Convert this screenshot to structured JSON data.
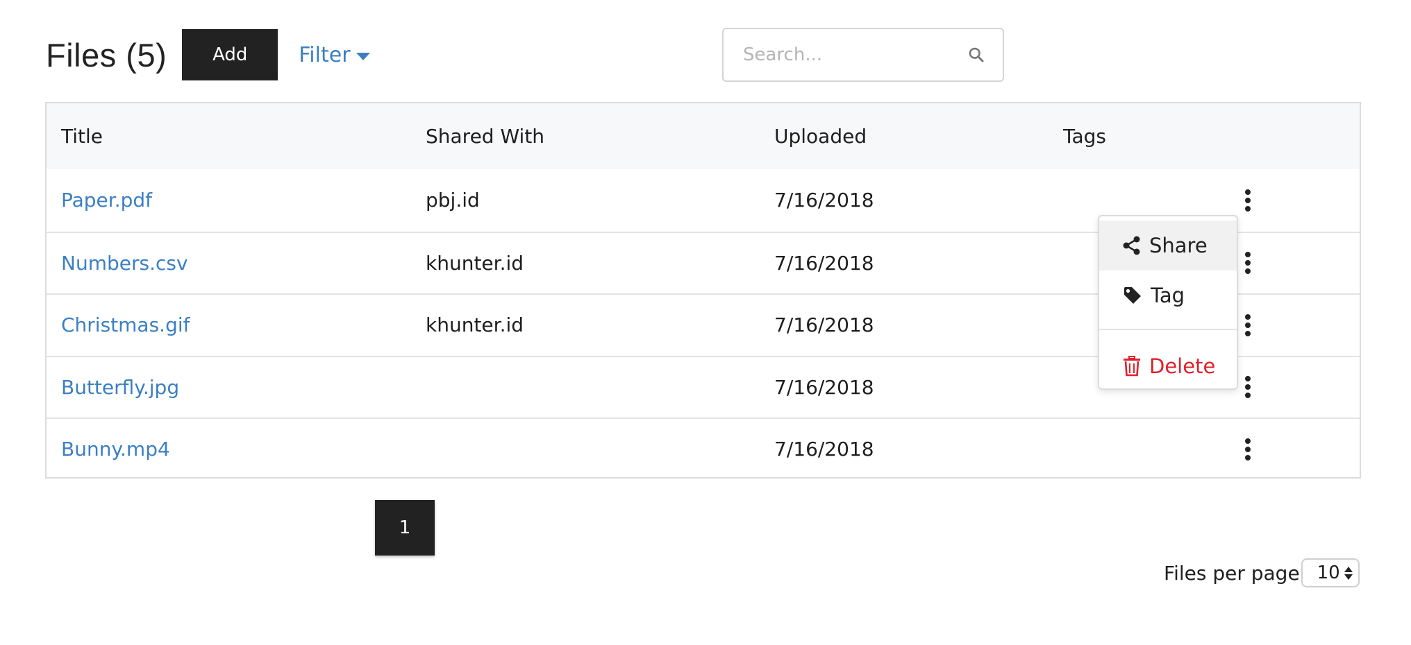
{
  "header": {
    "title": "Files (5)",
    "add_label": "Add",
    "filter_label": "Filter"
  },
  "search": {
    "placeholder": "Search..."
  },
  "table": {
    "columns": [
      "Title",
      "Shared With",
      "Uploaded",
      "Tags"
    ],
    "rows": [
      {
        "title": "Paper.pdf",
        "shared_with": "pbj.id",
        "uploaded": "7/16/2018",
        "tags": ""
      },
      {
        "title": "Numbers.csv",
        "shared_with": "khunter.id",
        "uploaded": "7/16/2018",
        "tags": ""
      },
      {
        "title": "Christmas.gif",
        "shared_with": "khunter.id",
        "uploaded": "7/16/2018",
        "tags": ""
      },
      {
        "title": "Butterfly.jpg",
        "shared_with": "",
        "uploaded": "7/16/2018",
        "tags": ""
      },
      {
        "title": "Bunny.mp4",
        "shared_with": "",
        "uploaded": "7/16/2018",
        "tags": ""
      }
    ]
  },
  "context_menu": {
    "items": [
      {
        "label": "Share",
        "icon": "share-icon"
      },
      {
        "label": "Tag",
        "icon": "tag-icon"
      },
      {
        "label": "Delete",
        "icon": "trash-icon"
      }
    ]
  },
  "pagination": {
    "current_page": "1",
    "per_page_label": "Files per page",
    "per_page_value": "10"
  },
  "colors": {
    "link": "#3b7fc4",
    "primary_button": "#222222",
    "danger": "#e0202a",
    "header_bg": "#f7f8fa"
  }
}
